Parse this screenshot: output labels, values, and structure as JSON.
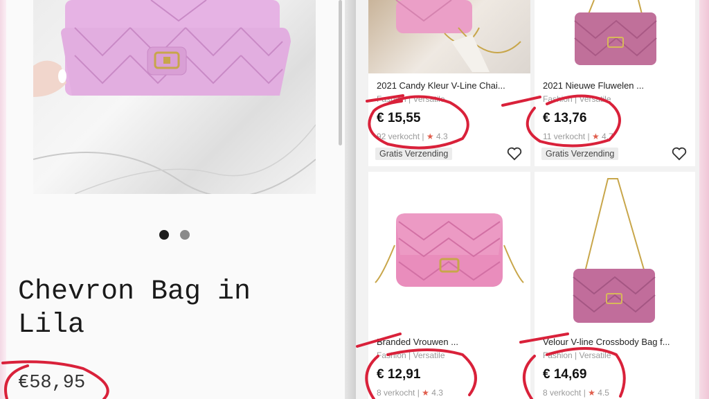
{
  "left": {
    "title": "Chevron Bag in Lila",
    "price": "€58,95"
  },
  "right": {
    "products": [
      {
        "title": "2021 Candy Kleur V-Line Chai...",
        "tags": "Fashion | Versatile",
        "price": "€ 15,55",
        "meta": "92 verkocht | ",
        "rating": "4.3",
        "badge": "Gratis Verzending"
      },
      {
        "title": "2021 Nieuwe Fluwelen ...",
        "tags": "Fashion | Versatile",
        "price": "€ 13,76",
        "meta": "11 verkocht | ",
        "rating": "4.7",
        "badge": "Gratis Verzending"
      },
      {
        "title": "Branded Vrouwen ...",
        "tags": "Fashion | Versatile",
        "price": "€ 12,91",
        "meta": "8 verkocht | ",
        "rating": "4.3"
      },
      {
        "title": "Velour V-line Crossbody Bag f...",
        "tags": "Fashion | Versatile",
        "price": "€ 14,69",
        "meta": "8 verkocht | ",
        "rating": "4.5"
      }
    ]
  },
  "colors": {
    "circle": "#d9213a",
    "star": "#e05d4c",
    "bag_pink": "#e89bc7",
    "bag_velvet": "#c0709a"
  },
  "icons": [
    "heart-icon",
    "star-icon",
    "carousel-dot"
  ]
}
